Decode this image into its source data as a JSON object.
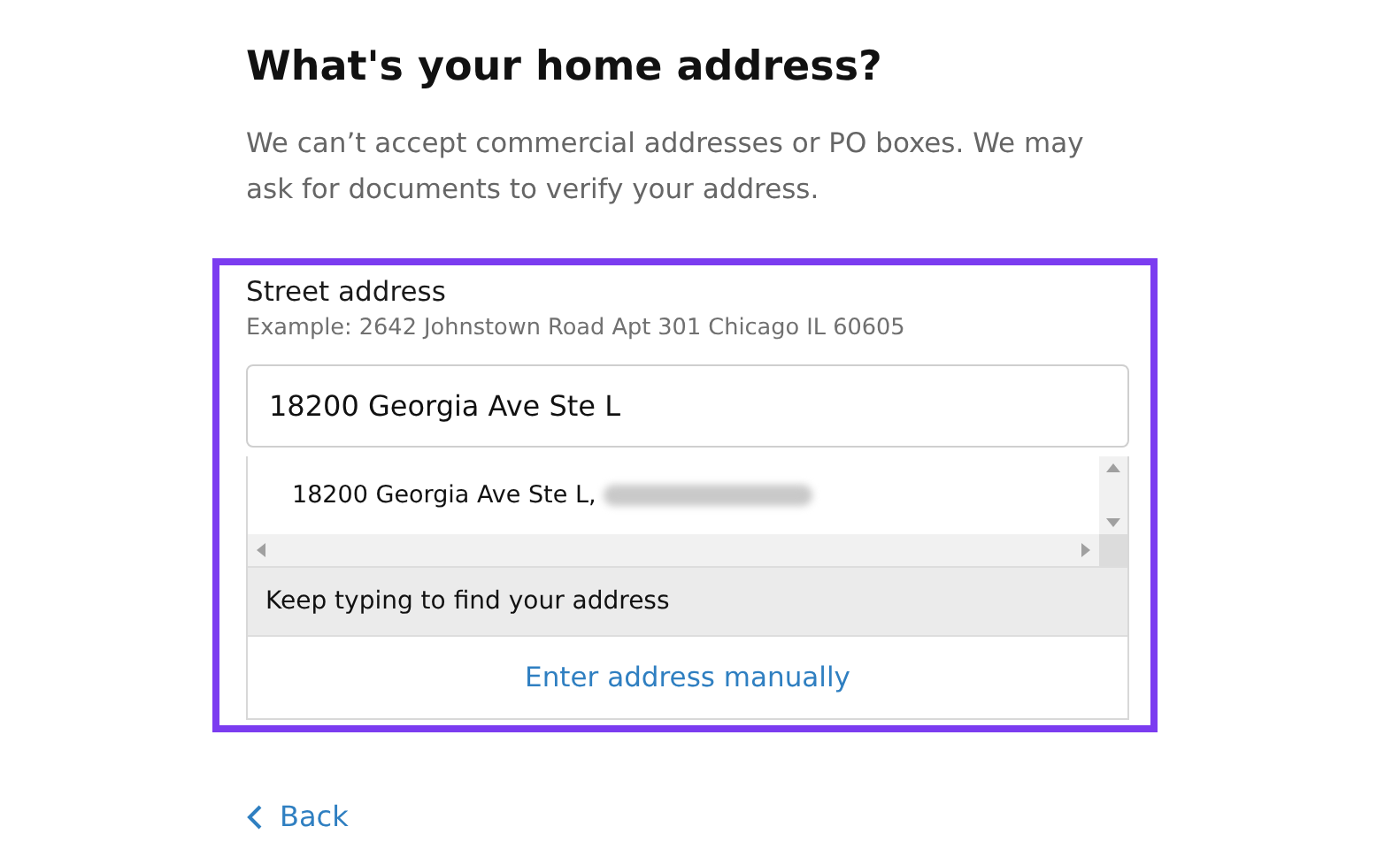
{
  "heading": "What's your home address?",
  "intro": "We can’t accept commercial addresses or PO boxes. We may ask for documents to verify your address.",
  "street_address": {
    "label": "Street address",
    "hint": "Example: 2642 Johnstown Road Apt 301 Chicago IL 60605",
    "value": "18200 Georgia Ave Ste L",
    "suggestions": [
      {
        "text": "18200 Georgia Ave Ste L,",
        "blurred": true
      }
    ],
    "status": "Keep typing to find your address",
    "manual_link": "Enter address manually"
  },
  "back": {
    "label": "Back"
  }
}
